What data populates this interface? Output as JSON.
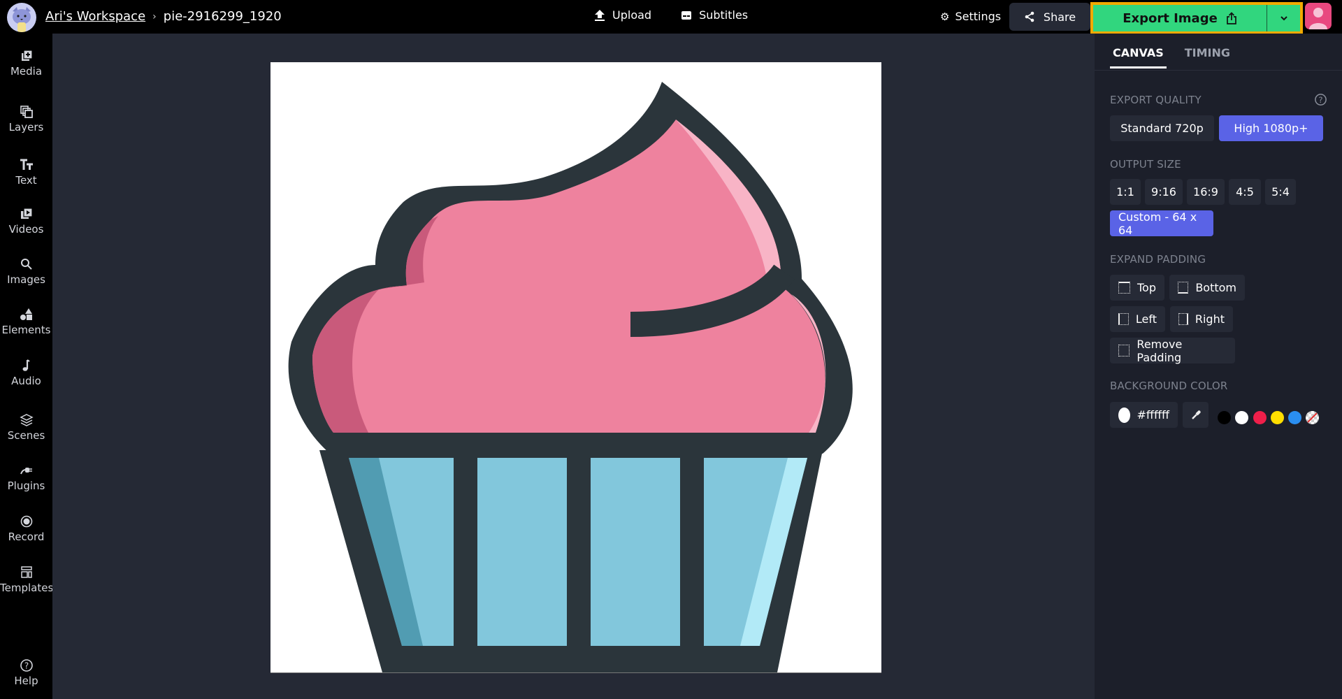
{
  "header": {
    "workspace_link": "Ari's Workspace",
    "breadcrumb_sep": "›",
    "project_name": "pie-2916299_1920",
    "upload_label": "Upload",
    "subtitles_label": "Subtitles",
    "settings_label": "Settings",
    "share_label": "Share",
    "export_label": "Export Image"
  },
  "sidebar": {
    "items": [
      {
        "label": "Media",
        "icon": "media-add-icon"
      },
      {
        "label": "Layers",
        "icon": "layers-icon"
      },
      {
        "label": "Text",
        "icon": "text-icon"
      },
      {
        "label": "Videos",
        "icon": "video-icon"
      },
      {
        "label": "Images",
        "icon": "search-icon"
      },
      {
        "label": "Elements",
        "icon": "shapes-icon"
      },
      {
        "label": "Audio",
        "icon": "music-note-icon"
      },
      {
        "label": "Scenes",
        "icon": "stack-icon"
      },
      {
        "label": "Plugins",
        "icon": "plug-icon"
      },
      {
        "label": "Record",
        "icon": "record-icon"
      },
      {
        "label": "Templates",
        "icon": "templates-icon"
      }
    ],
    "help_label": "Help"
  },
  "panel": {
    "tabs": [
      {
        "label": "CANVAS",
        "active": true
      },
      {
        "label": "TIMING",
        "active": false
      }
    ],
    "export_quality": {
      "title": "EXPORT QUALITY",
      "options": [
        {
          "label": "Standard 720p",
          "selected": false
        },
        {
          "label": "High 1080p+",
          "selected": true
        }
      ]
    },
    "output_size": {
      "title": "OUTPUT SIZE",
      "options": [
        "1:1",
        "9:16",
        "16:9",
        "4:5",
        "5:4"
      ],
      "custom_label": "Custom - 64 x 64",
      "custom_selected": true
    },
    "expand_padding": {
      "title": "EXPAND PADDING",
      "top": "Top",
      "bottom": "Bottom",
      "left": "Left",
      "right": "Right",
      "remove": "Remove Padding"
    },
    "background_color": {
      "title": "BACKGROUND COLOR",
      "value": "#ffffff",
      "swatches": [
        "#000000",
        "#ffffff",
        "#ef1f4a",
        "#ffde00",
        "#2a8ef0",
        "transparent"
      ]
    }
  },
  "canvas": {
    "background": "#ffffff",
    "image_subject": "cupcake",
    "colors": {
      "outline": "#2b353b",
      "frosting": "#ee829e",
      "frosting_shadow": "#c95a7b",
      "frosting_highlight": "#f8b4c6",
      "wrapper": "#82c7dc",
      "wrapper_shadow": "#519cb2",
      "wrapper_highlight": "#b2eaf7"
    }
  },
  "colors": {
    "accent": "#5a63e6",
    "export_green": "#31d67e",
    "export_border": "#f2a900",
    "user_avatar": "#e8487f"
  }
}
